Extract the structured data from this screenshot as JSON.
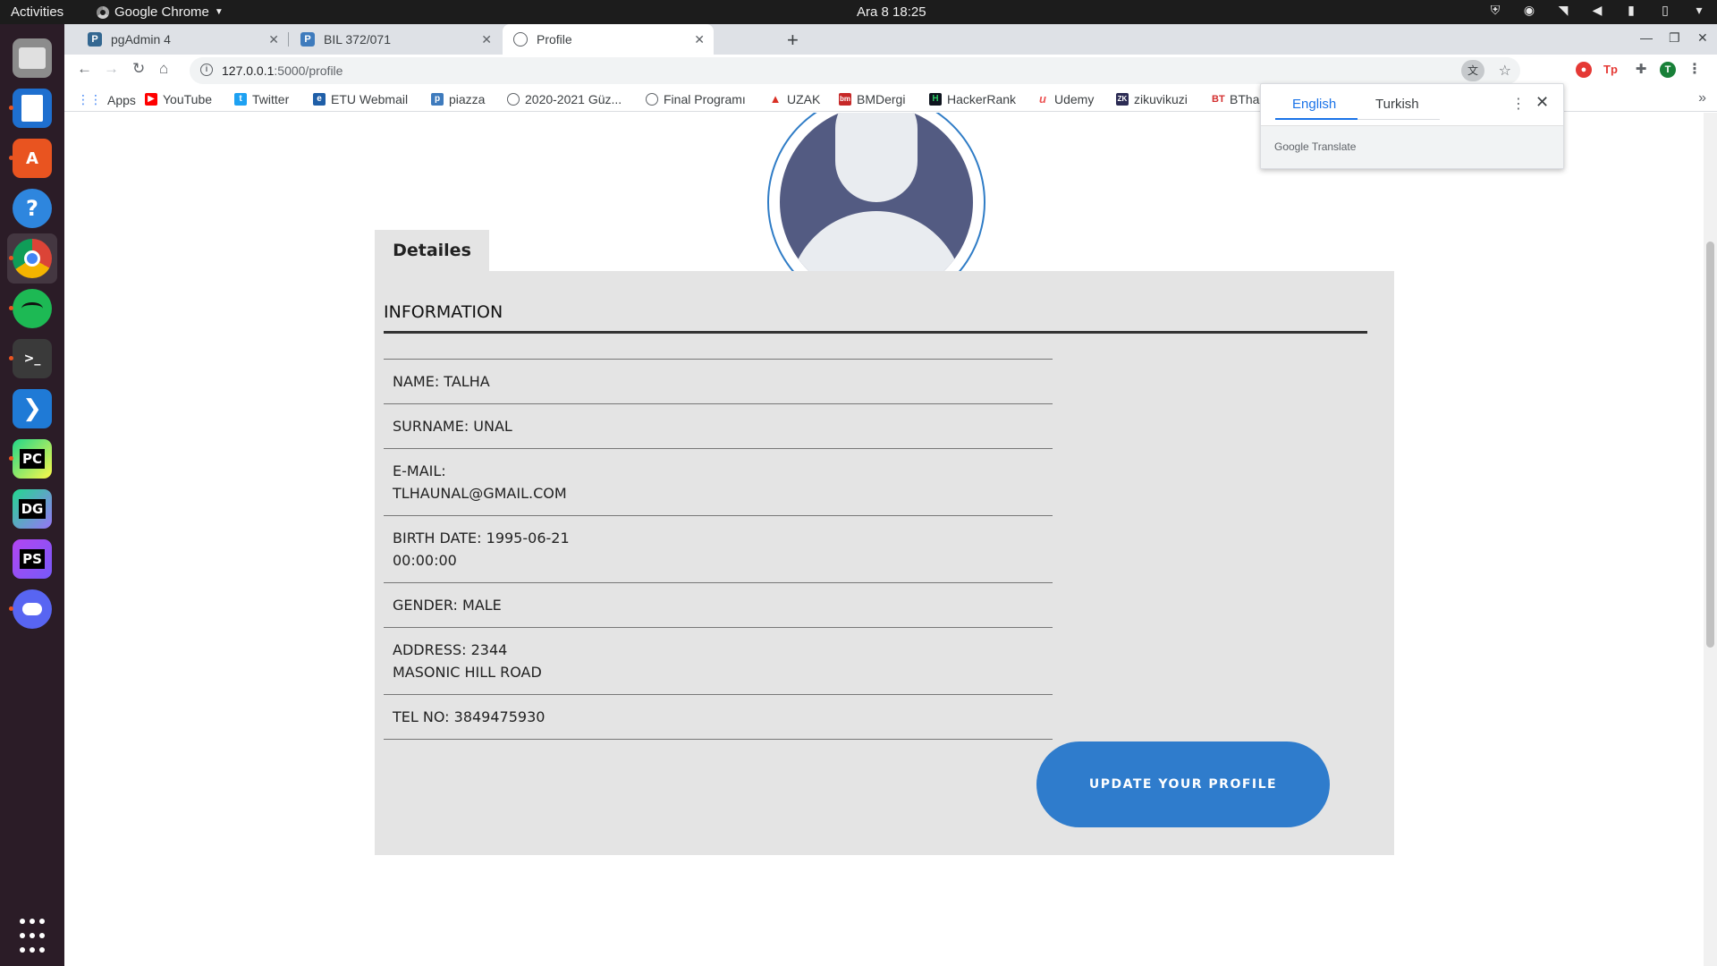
{
  "system_bar": {
    "activities": "Activities",
    "app_name": "Google Chrome",
    "clock": "Ara 8  18:25"
  },
  "browser": {
    "tabs": [
      {
        "title": "pgAdmin 4",
        "icon": "pgadmin-icon",
        "color": "#336791"
      },
      {
        "title": "BIL 372/071",
        "icon": "piazza-icon",
        "color": "#3e7bbd"
      },
      {
        "title": "Profile",
        "icon": "globe-icon",
        "color": "#5f6368"
      }
    ],
    "url_host": "127.0.0.1",
    "url_path": ":5000/profile",
    "profile_initial": "T",
    "bookmarks": [
      {
        "label": "Apps",
        "icon": "apps-grid-icon",
        "color": "#4285f4"
      },
      {
        "label": "YouTube",
        "icon": "youtube-icon",
        "color": "#ff0000"
      },
      {
        "label": "Twitter",
        "icon": "twitter-icon",
        "color": "#1da1f2"
      },
      {
        "label": "ETU Webmail",
        "icon": "webmail-icon",
        "color": "#1f5fa8"
      },
      {
        "label": "piazza",
        "icon": "piazza-icon",
        "color": "#3e7bbd"
      },
      {
        "label": "2020-2021 Güz...",
        "icon": "globe-icon",
        "color": "#5f6368"
      },
      {
        "label": "Final Programı",
        "icon": "globe-icon",
        "color": "#5f6368"
      },
      {
        "label": "UZAK",
        "icon": "uzak-icon",
        "color": "#d93025"
      },
      {
        "label": "BMDergi",
        "icon": "bmdergi-icon",
        "color": "#c62828"
      },
      {
        "label": "HackerRank",
        "icon": "hackerrank-icon",
        "color": "#0e141e"
      },
      {
        "label": "Udemy",
        "icon": "udemy-icon",
        "color": "#ec5252"
      },
      {
        "label": "zikuvikuzi",
        "icon": "zk-icon",
        "color": "#2c2c54"
      },
      {
        "label": "BTha",
        "icon": "bt-icon",
        "color": "#d32f2f"
      }
    ]
  },
  "translate_popup": {
    "lang_source": "English",
    "lang_target": "Turkish",
    "brand": "Google Translate"
  },
  "page": {
    "tab_label": "Detailes",
    "section_title": "INFORMATION",
    "fields": [
      {
        "text": "NAME: TALHA"
      },
      {
        "text": "SURNAME: UNAL"
      },
      {
        "text": "E-MAIL:\nTLHAUNAL@GMAIL.COM"
      },
      {
        "text": "BIRTH DATE: 1995-06-21\n00:00:00"
      },
      {
        "text": "GENDER: MALE"
      },
      {
        "text": "ADDRESS: 2344\nMASONIC HILL ROAD"
      },
      {
        "text": "TEL NO: 3849475930"
      }
    ],
    "update_button": "UPDATE YOUR PROFILE"
  },
  "dock": [
    {
      "name": "files-icon",
      "color": "#8c8c8c",
      "glyph": ""
    },
    {
      "name": "writer-icon",
      "color": "#1e6fcf",
      "glyph": ""
    },
    {
      "name": "software-center-icon",
      "color": "#e95420",
      "glyph": "A"
    },
    {
      "name": "help-icon",
      "color": "#2e86de",
      "glyph": "?"
    },
    {
      "name": "chrome-icon",
      "color": "#4285f4",
      "glyph": ""
    },
    {
      "name": "spotify-icon",
      "color": "#1db954",
      "glyph": ""
    },
    {
      "name": "terminal-icon",
      "color": "#3a3a3a",
      "glyph": ">_"
    },
    {
      "name": "vscode-icon",
      "color": "#1f7ad6",
      "glyph": ""
    },
    {
      "name": "pycharm-icon",
      "color": "#21d789",
      "glyph": "PC"
    },
    {
      "name": "datagrip-icon",
      "color": "#22a7a0",
      "glyph": "DG"
    },
    {
      "name": "phpstorm-icon",
      "color": "#9b4fe0",
      "glyph": "PS"
    },
    {
      "name": "discord-icon",
      "color": "#5865f2",
      "glyph": ""
    },
    {
      "name": "show-apps-icon",
      "color": "#2b1c27",
      "glyph": ""
    }
  ]
}
